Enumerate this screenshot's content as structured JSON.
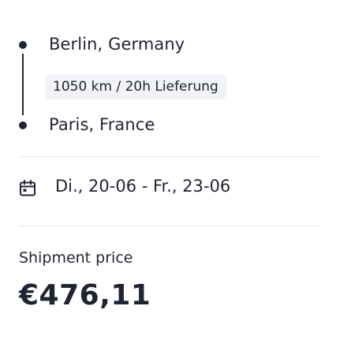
{
  "route": {
    "origin": "Berlin, Germany",
    "destination": "Paris, France",
    "leg": "1050 km / 20h Lieferung"
  },
  "schedule": {
    "dates": "Di., 20-06 - Fr., 23-06",
    "icon": "calendar-icon"
  },
  "price": {
    "label": "Shipment price",
    "value": "€476,11"
  }
}
